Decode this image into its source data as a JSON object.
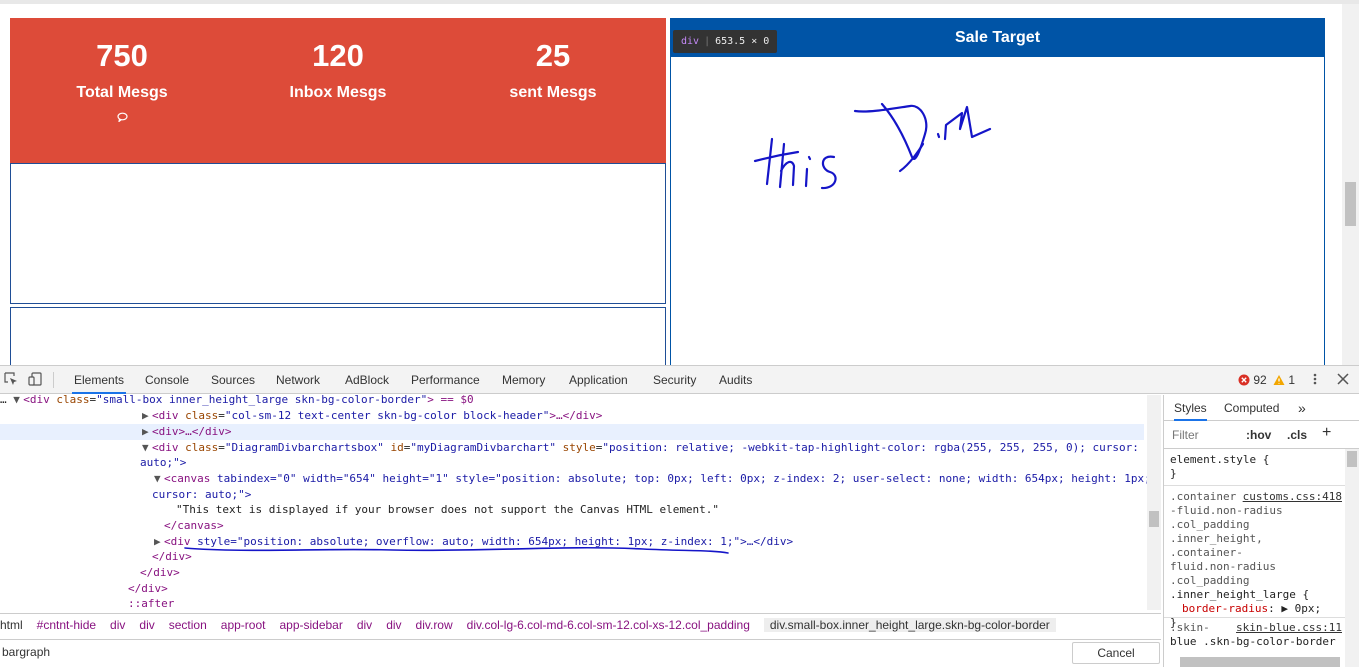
{
  "stats": [
    {
      "value": "750",
      "label": "Total Mesgs"
    },
    {
      "value": "120",
      "label": "Inbox Mesgs"
    },
    {
      "value": "25",
      "label": "sent Mesgs"
    }
  ],
  "sale_target": {
    "title": "Sale Target"
  },
  "inspect_tooltip": {
    "tag": "div",
    "size": "653.5 × 0"
  },
  "devtools": {
    "tabs": [
      "Elements",
      "Console",
      "Sources",
      "Network",
      "AdBlock",
      "Performance",
      "Memory",
      "Application",
      "Security",
      "Audits"
    ],
    "error_count": "92",
    "warning_count": "1",
    "dom_lines": {
      "l1_tag": "<div ",
      "l1_attr": "class",
      "l1_val": "\"small-box inner_height_large skn-bg-color-border\"",
      "l1_tail": "> == $0",
      "l2_a": "<div ",
      "l2_attr": "class",
      "l2_val": "\"col-sm-12 text-center skn-bg-color block-header\"",
      "l2_tail": ">…</div>",
      "l3": "<div>…</div>",
      "l4_a": "<div ",
      "l4_attr1": "class",
      "l4_val1": "\"DiagramDivbarchartsbox\"",
      "l4_attr2": "id",
      "l4_val2": "\"myDiagramDivbarchart\"",
      "l4_attr3": "style",
      "l4_val3": "\"position: relative; -webkit-tap-highlight-color: rgba(255, 255, 255, 0); cursor:",
      "l5": "auto;\">",
      "l6_a": "<canvas ",
      "l6_rest": "tabindex=\"0\" width=\"654\" height=\"1\" style=\"position: absolute; top: 0px; left: 0px; z-index: 2; user-select: none; width: 654px; height: 1px;",
      "l7": "cursor: auto;\">",
      "l8": "\"This text is displayed if your browser does not support the Canvas HTML element.\"",
      "l9": "</canvas>",
      "l10_a": "<div ",
      "l10_rest": "style=\"position: absolute; overflow: auto; width: 654px; height: 1px; z-index: 1;\">…</div>",
      "l11": "</div>",
      "l12": "</div>",
      "l13": "</div>",
      "l14": "::after"
    },
    "breadcrumbs": [
      "html",
      "#cntnt-hide",
      "div",
      "div",
      "section",
      "app-root",
      "app-sidebar",
      "div",
      "div",
      "div.row",
      "div.col-lg-6.col-md-6.col-sm-12.col-xs-12.col_padding",
      "div.small-box.inner_height_large.skn-bg-color-border"
    ],
    "search_query": "bargraph",
    "cancel_label": "Cancel",
    "styles": {
      "tab_styles": "Styles",
      "tab_computed": "Computed",
      "more": "»",
      "filter_placeholder": "Filter",
      "hov": ":hov",
      "cls": ".cls",
      "add": "+",
      "element_style": "element.style {",
      "close_brace": "}",
      "rule1_link": "customs.css:418",
      "rule1_sel": ".container-fluid.non-radius .col_padding .inner_height, .container-fluid.non-radius .col_padding .inner_height_large {",
      "rule1_sel_a": ".container",
      "rule1_sel_b": "-fluid.non-radius",
      "rule1_sel_c": ".col_padding",
      "rule1_sel_d": ".inner_height, .container-",
      "rule1_sel_e": "fluid.non-radius",
      "rule1_sel_f": ".col_padding",
      "rule1_sel_g": ".inner_height_large {",
      "rule1_prop": "border-radius",
      "rule1_val": "▶ 0px;",
      "rule2_sel_a": ".skin-",
      "rule2_link": "skin-blue.css:11",
      "rule2_sel_b": "blue .skn-bg-color-border"
    }
  }
}
